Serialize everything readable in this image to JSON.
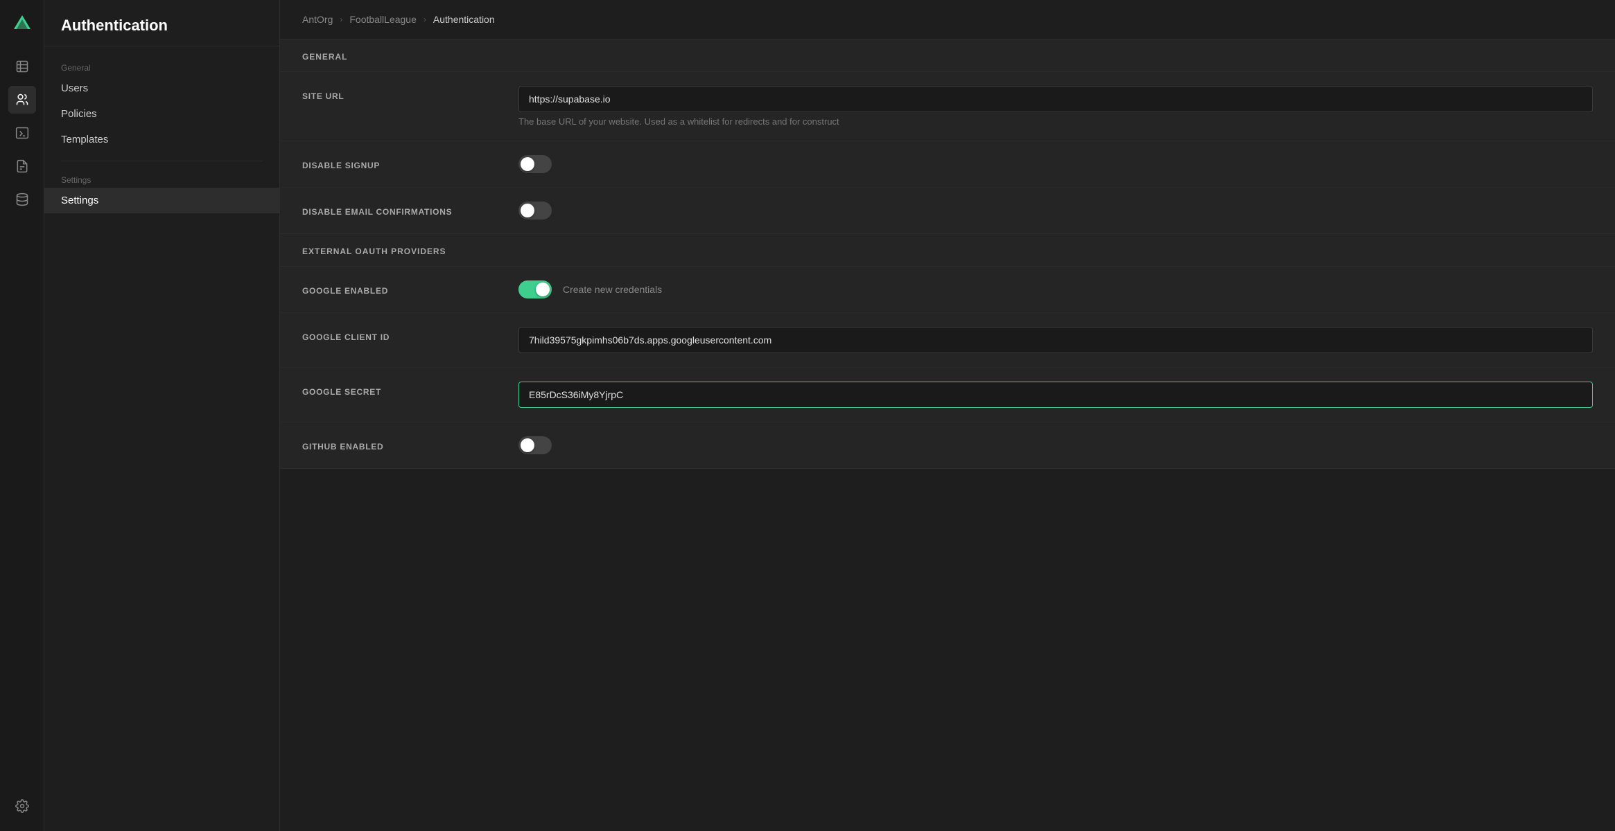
{
  "app": {
    "title": "Authentication"
  },
  "breadcrumb": {
    "org": "AntOrg",
    "project": "FootballLeague",
    "page": "Authentication"
  },
  "sidebar": {
    "nav_icons": [
      {
        "name": "table-icon",
        "label": "Table"
      },
      {
        "name": "users-icon",
        "label": "Users"
      },
      {
        "name": "terminal-icon",
        "label": "Terminal"
      },
      {
        "name": "document-icon",
        "label": "Document"
      },
      {
        "name": "database-icon",
        "label": "Database"
      },
      {
        "name": "gear-icon",
        "label": "Settings"
      }
    ]
  },
  "left_nav": {
    "general_label": "General",
    "items_general": [
      {
        "id": "users",
        "label": "Users",
        "active": false
      },
      {
        "id": "policies",
        "label": "Policies",
        "active": false
      },
      {
        "id": "templates",
        "label": "Templates",
        "active": false
      }
    ],
    "settings_label": "Settings",
    "items_settings": [
      {
        "id": "settings",
        "label": "Settings",
        "active": true
      }
    ]
  },
  "general_section": {
    "title": "GENERAL",
    "site_url": {
      "label": "SITE URL",
      "value": "https://supabase.io",
      "hint": "The base URL of your website. Used as a whitelist for redirects and for construct"
    },
    "disable_signup": {
      "label": "DISABLE SIGNUP",
      "enabled": false
    },
    "disable_email_confirmations": {
      "label": "DISABLE EMAIL CONFIRMATIONS",
      "enabled": false
    }
  },
  "oauth_section": {
    "title": "EXTERNAL OAUTH PROVIDERS",
    "google_enabled": {
      "label": "GOOGLE ENABLED",
      "enabled": true,
      "link_text": "Create new credentials"
    },
    "google_client_id": {
      "label": "GOOGLE CLIENT ID",
      "value": "7hild39575gkpimhs06b7ds.apps.googleusercontent.com"
    },
    "google_secret": {
      "label": "GOOGLE SECRET",
      "value": "E85rDcS36iMy8YjrpC",
      "focused": true
    },
    "github_enabled": {
      "label": "GITHUB ENABLED",
      "enabled": false
    }
  }
}
